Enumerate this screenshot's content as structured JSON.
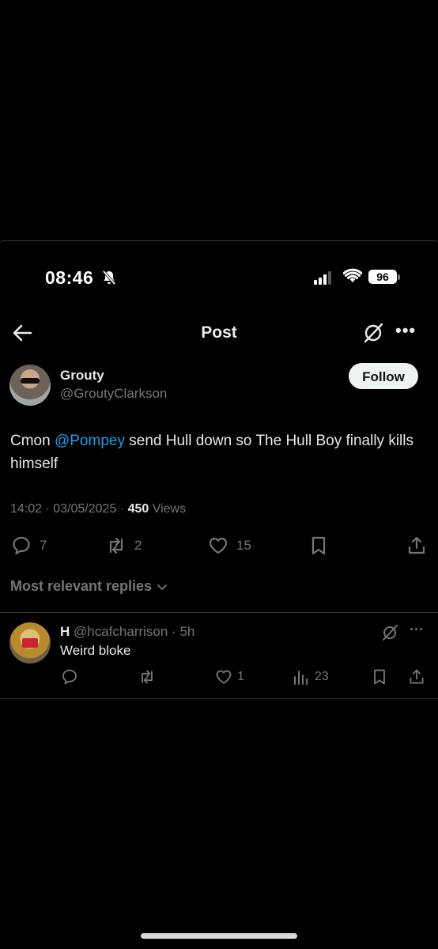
{
  "status_bar": {
    "time": "08:46",
    "battery": "96"
  },
  "header": {
    "title": "Post"
  },
  "post": {
    "author_name": "Grouty",
    "author_handle": "@GroutyClarkson",
    "follow_label": "Follow",
    "text_before": "Cmon ",
    "mention": "@Pompey",
    "text_after": " send Hull down so The Hull Boy finally kills himself",
    "time": "14:02",
    "date": "03/05/2025",
    "views_count": "450",
    "views_label": "Views",
    "replies": "7",
    "reposts": "2",
    "likes": "15"
  },
  "replies_sort": {
    "label": "Most relevant replies"
  },
  "reply": {
    "name": "H",
    "handle": "@hcafcharrison",
    "age": "5h",
    "text": "Weird bloke",
    "likes": "1",
    "views": "23"
  },
  "colors": {
    "accent": "#1d9bf0",
    "muted": "#71767b",
    "text": "#e7e9ea",
    "background": "#000000"
  },
  "icons": [
    "bell-slash-icon",
    "signal-icon",
    "wifi-icon",
    "back-arrow-icon",
    "grok-icon",
    "more-icon",
    "reply-icon",
    "repost-icon",
    "like-icon",
    "bookmark-icon",
    "share-icon",
    "chevron-down-icon",
    "views-icon"
  ]
}
